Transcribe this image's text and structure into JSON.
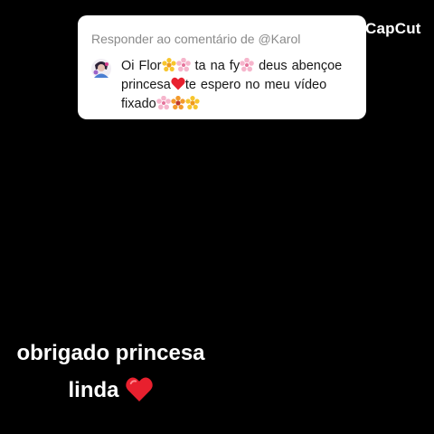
{
  "reply": {
    "header": "Responder ao comentário de @Karol",
    "comment": {
      "seg1": "Oi Flor",
      "seg2": " ta na fy",
      "seg3": " deus abençoe princesa",
      "seg4": "te espero no meu vídeo fixado"
    }
  },
  "watermark": {
    "text": "CapCut"
  },
  "caption": {
    "line1": "obrigado princesa",
    "line2": "linda"
  },
  "icons": {
    "avatar": "user-avatar",
    "sunflower": "blossom-yellow-emoji",
    "cherry": "cherry-blossom-emoji",
    "heart": "red-heart-emoji",
    "flower": "orange-flower-emoji"
  },
  "colors": {
    "background": "#000000",
    "card": "#ffffff",
    "header_text": "#8a8a8a",
    "body_text": "#161616",
    "heart": "#e8202e"
  }
}
